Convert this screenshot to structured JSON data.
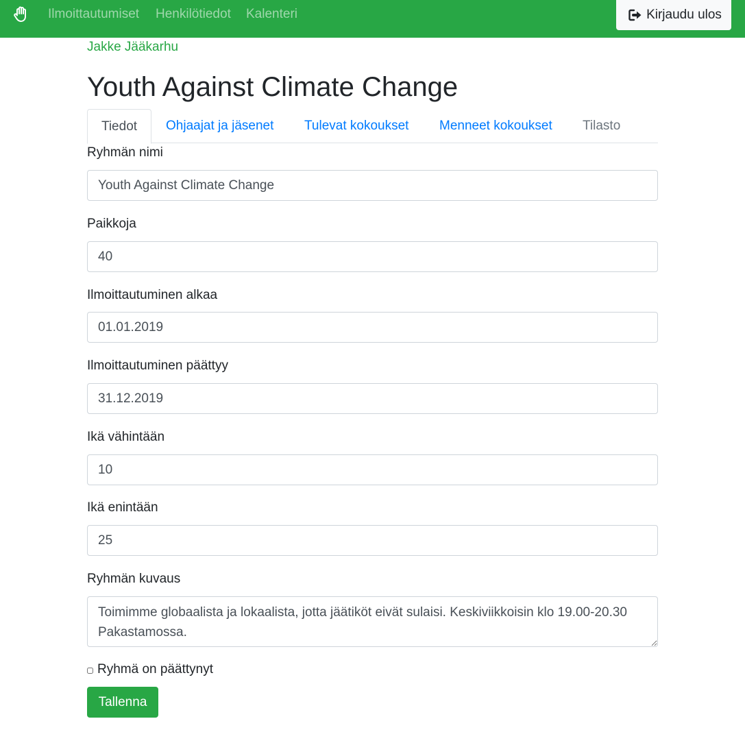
{
  "navbar": {
    "brand_icon": "hand-paper-icon",
    "links": [
      "Ilmoittautumiset",
      "Henkilötiedot",
      "Kalenteri"
    ],
    "logout_icon": "sign-out-icon",
    "logout_label": "Kirjaudu ulos",
    "background_color": "#28a745"
  },
  "user": {
    "name": "Jakke Jääkarhu"
  },
  "page": {
    "title": "Youth Against Climate Change"
  },
  "tabs": [
    {
      "label": "Tiedot",
      "state": "active"
    },
    {
      "label": "Ohjaajat ja jäsenet",
      "state": "link"
    },
    {
      "label": "Tulevat kokoukset",
      "state": "link"
    },
    {
      "label": "Menneet kokoukset",
      "state": "link"
    },
    {
      "label": "Tilasto",
      "state": "disabled"
    }
  ],
  "form": {
    "fields": [
      {
        "label": "Ryhmän nimi",
        "value": "Youth Against Climate Change"
      },
      {
        "label": "Paikkoja",
        "value": "40"
      },
      {
        "label": "Ilmoittautuminen alkaa",
        "value": "01.01.2019"
      },
      {
        "label": "Ilmoittautuminen päättyy",
        "value": "31.12.2019"
      },
      {
        "label": "Ikä vähintään",
        "value": "10"
      },
      {
        "label": "Ikä enintään",
        "value": "25"
      }
    ],
    "description": {
      "label": "Ryhmän kuvaus",
      "value": "Toimimme globaalista ja lokaalista, jotta jäätiköt eivät sulaisi. Keskiviikkoisin klo 19.00-20.30 Pakastamossa."
    },
    "ended_checkbox": {
      "label": "Ryhmä on päättynyt",
      "checked": false
    },
    "save_label": "Tallenna"
  },
  "colors": {
    "primary_green": "#28a745",
    "link_blue": "#007bff",
    "muted": "#6c757d"
  }
}
